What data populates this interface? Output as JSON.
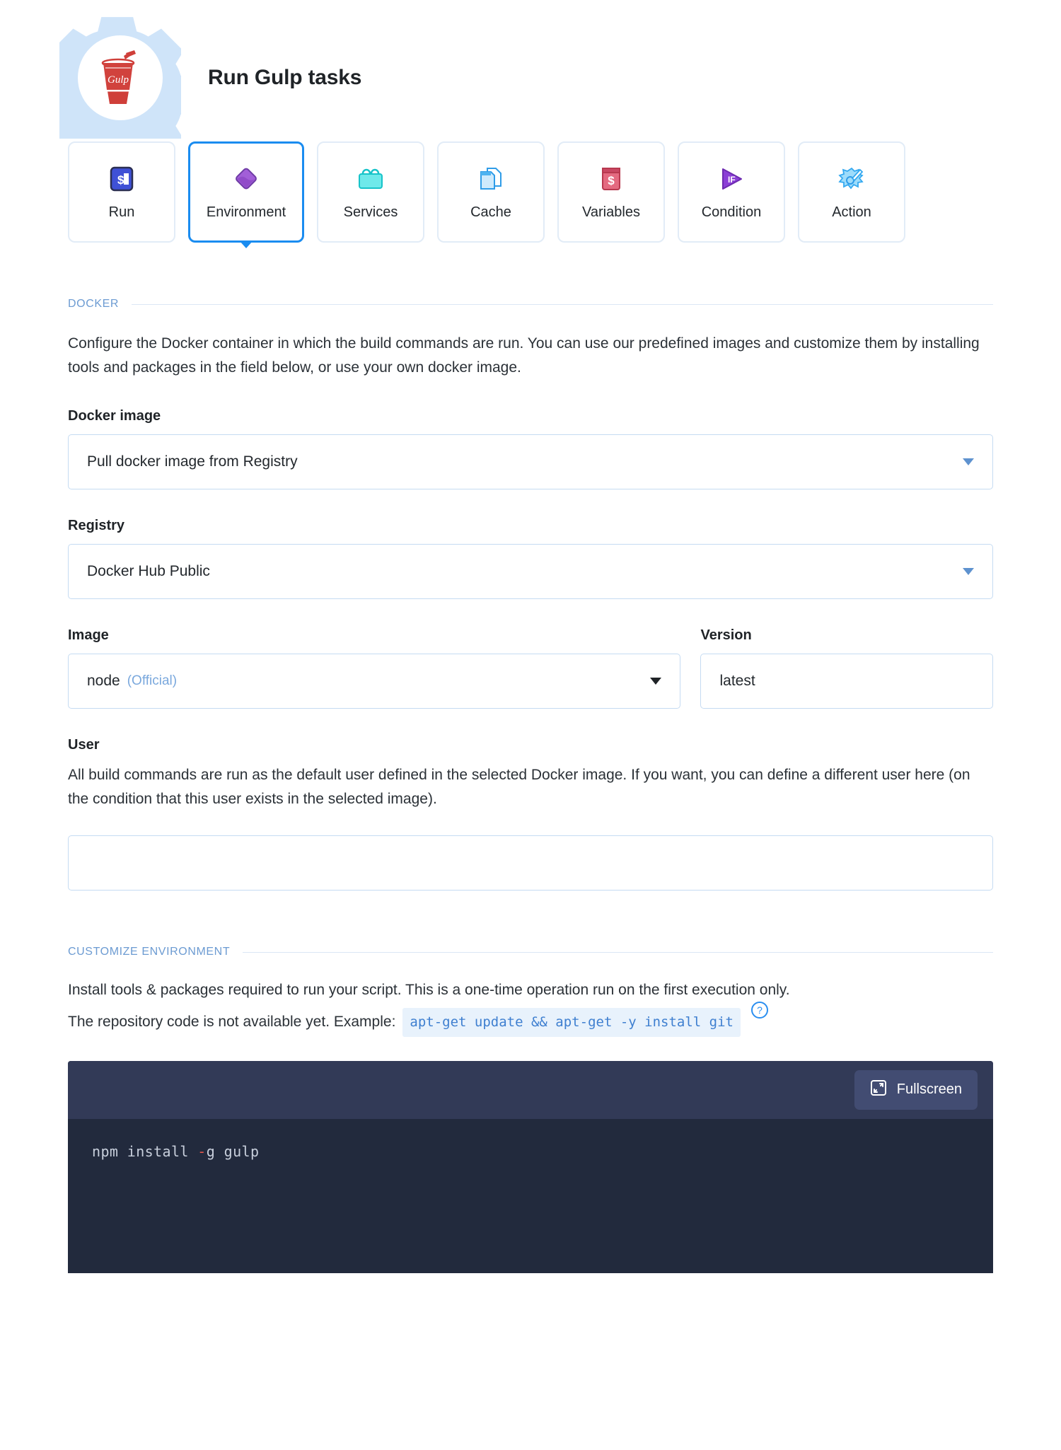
{
  "header": {
    "title": "Run Gulp tasks",
    "logo_icon": "gulp-logo-icon",
    "gear_icon": "gear-icon"
  },
  "tabs": [
    {
      "label": "Run",
      "icon": "terminal-dollar-icon",
      "active": false
    },
    {
      "label": "Environment",
      "icon": "purple-diamond-icon",
      "active": true
    },
    {
      "label": "Services",
      "icon": "services-bag-icon",
      "active": false
    },
    {
      "label": "Cache",
      "icon": "cache-file-icon",
      "active": false
    },
    {
      "label": "Variables",
      "icon": "variables-book-icon",
      "active": false
    },
    {
      "label": "Condition",
      "icon": "condition-if-icon",
      "active": false
    },
    {
      "label": "Action",
      "icon": "magic-wand-icon",
      "active": false
    }
  ],
  "docker": {
    "section_title": "DOCKER",
    "description": "Configure the Docker container in which the build commands are run. You can use our predefined images and customize them by installing tools and packages in the field below, or use your own docker image.",
    "docker_image_label": "Docker image",
    "docker_image_value": "Pull docker image from Registry",
    "registry_label": "Registry",
    "registry_value": "Docker Hub Public",
    "image_label": "Image",
    "image_value": "node",
    "image_value_suffix": "(Official)",
    "version_label": "Version",
    "version_value": "latest",
    "user_label": "User",
    "user_description": "All build commands are run as the default user defined in the selected Docker image. If you want, you can define a different user here (on the condition that this user exists in the selected image).",
    "user_value": "",
    "user_placeholder": ""
  },
  "customize": {
    "section_title": "CUSTOMIZE ENVIRONMENT",
    "description_line1": "Install tools & packages required to run your script. This is a one-time operation run on the first execution only.",
    "description_line2": "The repository code is not available yet. Example:",
    "example_code": "apt-get update && apt-get -y install git",
    "help_icon": "help-circle-icon",
    "editor": {
      "fullscreen_label": "Fullscreen",
      "fullscreen_icon": "fullscreen-expand-icon",
      "code_prefix": "npm install ",
      "code_dash": "-",
      "code_suffix": "g gulp"
    }
  },
  "colors": {
    "accent_blue": "#1a8cf0",
    "section_label": "#6c9bd2",
    "border_light": "#c5dbf2",
    "editor_bg": "#222a3d",
    "editor_bar": "#323a57"
  }
}
